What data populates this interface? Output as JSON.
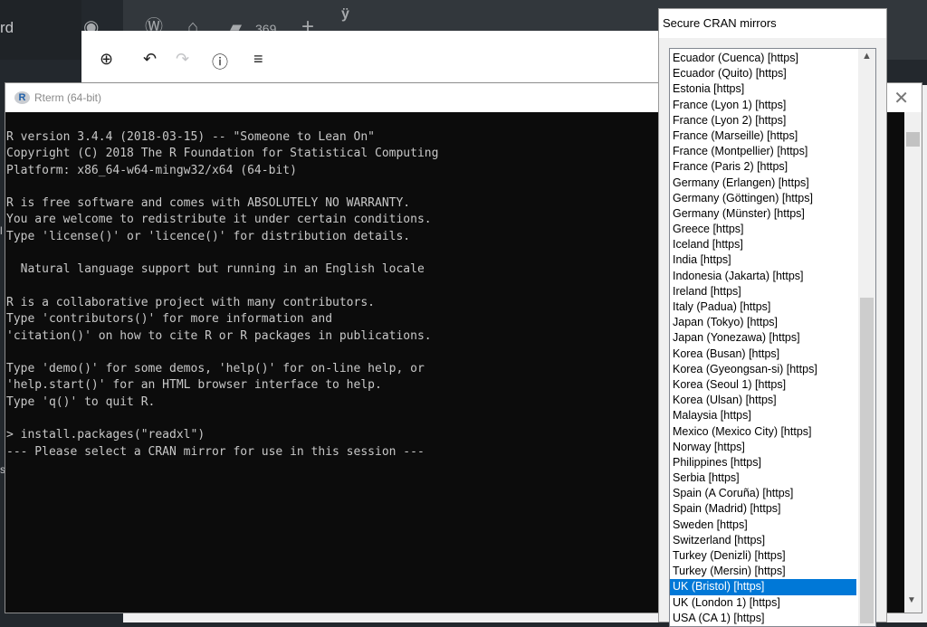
{
  "wordpress": {
    "sidebar_text": "rd",
    "comment_count": "369",
    "side_glyph_1": "l",
    "side_glyph_2": "s"
  },
  "rterm": {
    "title": "Rterm (64-bit)",
    "console_lines": [
      "R version 3.4.4 (2018-03-15) -- \"Someone to Lean On\"",
      "Copyright (C) 2018 The R Foundation for Statistical Computing",
      "Platform: x86_64-w64-mingw32/x64 (64-bit)",
      "",
      "R is free software and comes with ABSOLUTELY NO WARRANTY.",
      "You are welcome to redistribute it under certain conditions.",
      "Type 'license()' or 'licence()' for distribution details.",
      "",
      "  Natural language support but running in an English locale",
      "",
      "R is a collaborative project with many contributors.",
      "Type 'contributors()' for more information and",
      "'citation()' on how to cite R or R packages in publications.",
      "",
      "Type 'demo()' for some demos, 'help()' for on-line help, or",
      "'help.start()' for an HTML browser interface to help.",
      "Type 'q()' to quit R.",
      "",
      "> install.packages(\"readxl\")",
      "--- Please select a CRAN mirror for use in this session ---"
    ]
  },
  "cran_dialog": {
    "title": "Secure CRAN mirrors",
    "selected_mirror": "UK (Bristol) [https]",
    "mirrors": [
      "Ecuador (Cuenca) [https]",
      "Ecuador (Quito) [https]",
      "Estonia [https]",
      "France (Lyon 1) [https]",
      "France (Lyon 2) [https]",
      "France (Marseille) [https]",
      "France (Montpellier) [https]",
      "France (Paris 2) [https]",
      "Germany (Erlangen) [https]",
      "Germany (Göttingen) [https]",
      "Germany (Münster) [https]",
      "Greece [https]",
      "Iceland [https]",
      "India [https]",
      "Indonesia (Jakarta) [https]",
      "Ireland [https]",
      "Italy (Padua) [https]",
      "Japan (Tokyo) [https]",
      "Japan (Yonezawa) [https]",
      "Korea (Busan) [https]",
      "Korea (Gyeongsan-si) [https]",
      "Korea (Seoul 1) [https]",
      "Korea (Ulsan) [https]",
      "Malaysia [https]",
      "Mexico (Mexico City) [https]",
      "Norway [https]",
      "Philippines [https]",
      "Serbia [https]",
      "Spain (A Coruña) [https]",
      "Spain (Madrid) [https]",
      "Sweden [https]",
      "Switzerland [https]",
      "Turkey (Denizli) [https]",
      "Turkey (Mersin) [https]",
      "UK (Bristol) [https]",
      "UK (London 1) [https]",
      "USA (CA 1) [https]"
    ]
  },
  "icons": [
    "customize-icon",
    "wordpress-logo-icon",
    "home-icon",
    "comment-icon",
    "plus-icon",
    "yoast-icon",
    "add-block-icon",
    "undo-icon",
    "redo-icon",
    "info-icon",
    "outline-icon",
    "r-logo-icon",
    "close-icon",
    "scroll-up-icon",
    "scroll-down-icon"
  ],
  "colors": {
    "selection": "#0078d7",
    "console_bg": "#0c0c0c",
    "console_text": "#c8c8c8",
    "wp_bar": "#32373c"
  }
}
